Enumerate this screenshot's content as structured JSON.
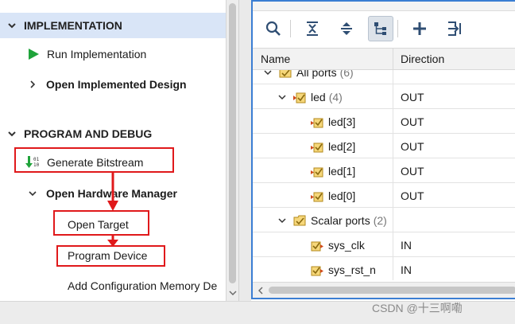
{
  "flow_navigator": {
    "implementation": {
      "title": "IMPLEMENTATION",
      "items": [
        {
          "label": "Run Implementation",
          "icon": "play-icon"
        },
        {
          "label": "Open Implemented Design",
          "icon": "chevron-right-icon"
        }
      ]
    },
    "program_debug": {
      "title": "PROGRAM AND DEBUG",
      "items": [
        {
          "label": "Generate Bitstream",
          "icon": "bitstream-icon"
        },
        {
          "label": "Open Hardware Manager",
          "icon": "chevron-down-icon"
        },
        {
          "label": "Open Target"
        },
        {
          "label": "Program Device"
        },
        {
          "label": "Add Configuration Memory De"
        }
      ]
    }
  },
  "ports_panel": {
    "toolbar": [
      "search-icon",
      "collapse-all-icon",
      "expand-all-icon",
      "hierarchy-icon",
      "add-icon",
      "export-icon"
    ],
    "columns": {
      "name": "Name",
      "direction": "Direction"
    },
    "rows": [
      {
        "name": "All ports",
        "count": "(6)",
        "direction": ""
      },
      {
        "name": "led",
        "count": "(4)",
        "direction": "OUT"
      },
      {
        "name": "led[3]",
        "count": "",
        "direction": "OUT"
      },
      {
        "name": "led[2]",
        "count": "",
        "direction": "OUT"
      },
      {
        "name": "led[1]",
        "count": "",
        "direction": "OUT"
      },
      {
        "name": "led[0]",
        "count": "",
        "direction": "OUT"
      },
      {
        "name": "Scalar ports",
        "count": "(2)",
        "direction": ""
      },
      {
        "name": "sys_clk",
        "count": "",
        "direction": "IN"
      },
      {
        "name": "sys_rst_n",
        "count": "",
        "direction": "IN"
      }
    ]
  },
  "colors": {
    "accent": "#3b7ed3",
    "annotation": "#e0191b",
    "selection": "#d9e5f7",
    "run_green": "#1fa33a"
  },
  "watermark": "CSDN @十三啊嘞"
}
